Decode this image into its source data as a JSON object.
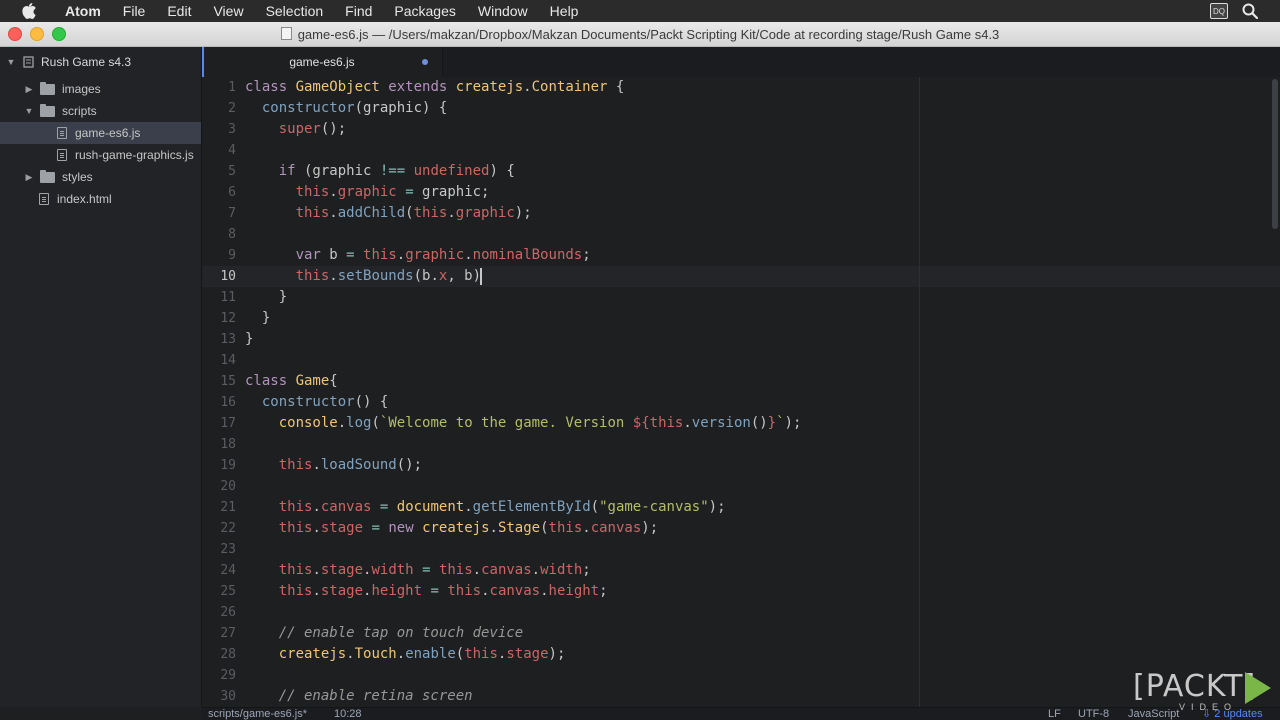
{
  "menubar": {
    "app_name": "Atom",
    "items": [
      "File",
      "Edit",
      "View",
      "Selection",
      "Find",
      "Packages",
      "Window",
      "Help"
    ],
    "dq_badge": "DQ"
  },
  "window": {
    "title": "game-es6.js — /Users/makzan/Dropbox/Makzan Documents/Packt Scripting Kit/Code at recording stage/Rush Game s4.3"
  },
  "tree": {
    "project": "Rush Game s4.3",
    "images": "images",
    "scripts": "scripts",
    "file_game": "game-es6.js",
    "file_graphics": "rush-game-graphics.js",
    "styles": "styles",
    "index": "index.html"
  },
  "tab": {
    "label": "game-es6.js"
  },
  "editor": {
    "line_numbers": [
      "1",
      "2",
      "3",
      "4",
      "5",
      "6",
      "7",
      "8",
      "9",
      "10",
      "11",
      "12",
      "13",
      "14",
      "15",
      "16",
      "17",
      "18",
      "19",
      "20",
      "21",
      "22",
      "23",
      "24",
      "25",
      "26",
      "27",
      "28",
      "29",
      "30"
    ],
    "current_line": "10"
  },
  "status": {
    "path": "scripts/game-es6.js*",
    "cursor": "10:28",
    "line_ending": "LF",
    "encoding": "UTF-8",
    "grammar": "JavaScript",
    "updates": "2 updates"
  },
  "watermark": {
    "brand": "[PACKT]",
    "sub": "VIDEO"
  }
}
